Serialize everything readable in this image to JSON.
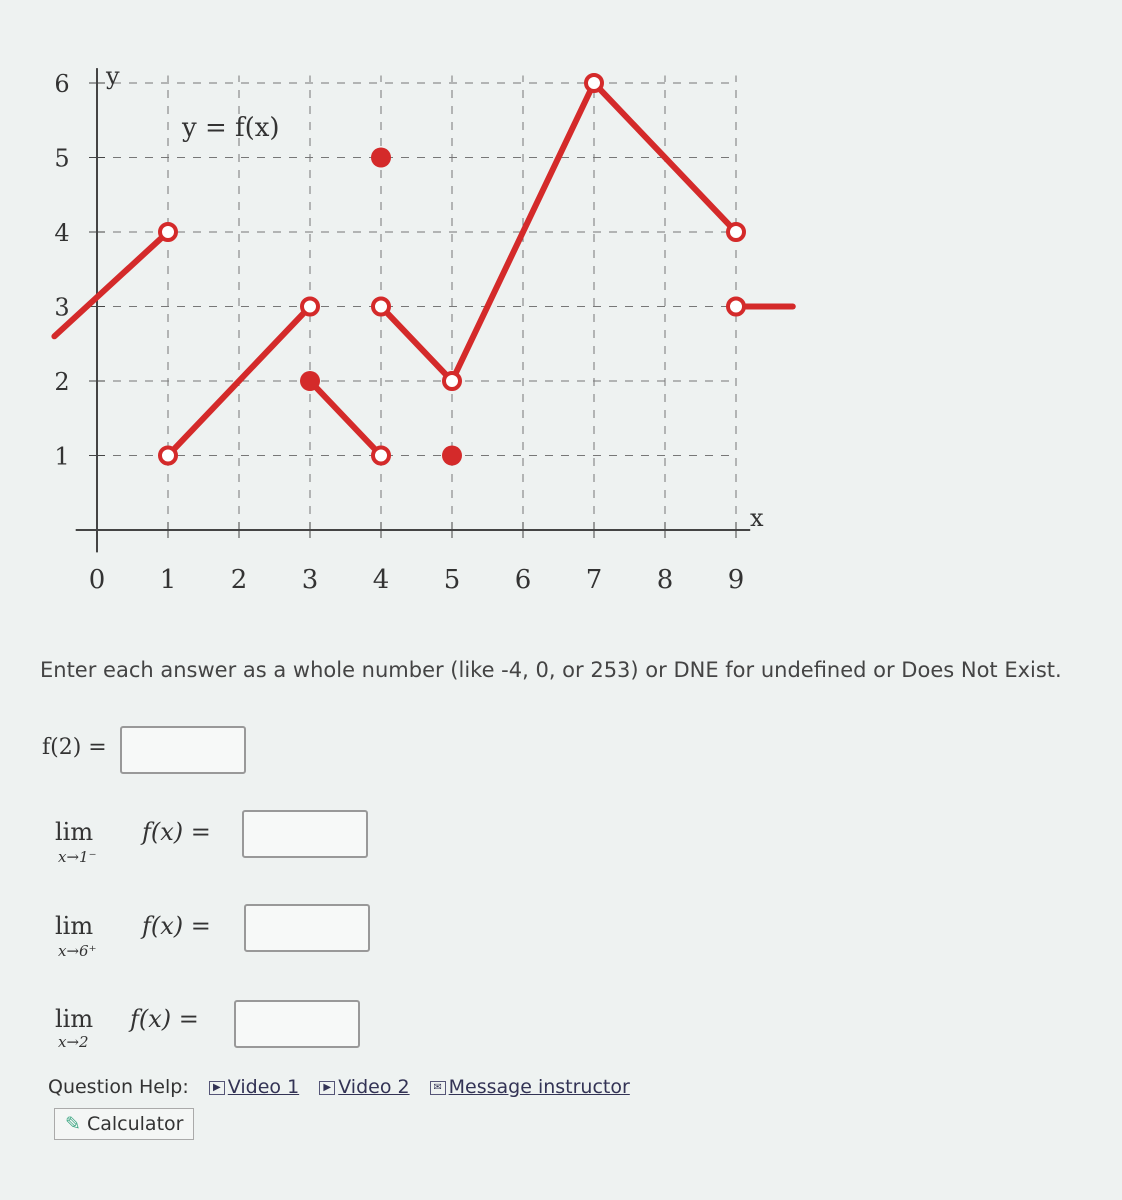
{
  "graph": {
    "title": "y = f(x)",
    "xlabel": "x",
    "ylabel": "y",
    "x_ticks": [
      "0",
      "1",
      "2",
      "3",
      "4",
      "5",
      "6",
      "7",
      "8",
      "9"
    ],
    "y_ticks": [
      "1",
      "2",
      "3",
      "4",
      "5",
      "6"
    ],
    "line_color": "#d42a2a",
    "segments": [
      [
        [
          -0.6,
          2.6
        ],
        [
          1,
          4
        ]
      ],
      [
        [
          1,
          1
        ],
        [
          3,
          3
        ]
      ],
      [
        [
          3,
          2
        ],
        [
          4,
          1
        ]
      ],
      [
        [
          4,
          3
        ],
        [
          5,
          2
        ]
      ],
      [
        [
          5,
          2
        ],
        [
          7,
          6
        ]
      ],
      [
        [
          7,
          6
        ],
        [
          9,
          4
        ]
      ],
      [
        [
          9,
          3
        ],
        [
          9.8,
          3
        ]
      ]
    ],
    "open_points": [
      [
        1,
        4
      ],
      [
        1,
        1
      ],
      [
        3,
        3
      ],
      [
        4,
        1
      ],
      [
        4,
        3
      ],
      [
        5,
        2
      ],
      [
        7,
        6
      ],
      [
        9,
        4
      ],
      [
        9,
        3
      ]
    ],
    "closed_points": [
      [
        3,
        2
      ],
      [
        4,
        5
      ],
      [
        5,
        1
      ]
    ]
  },
  "instructions": "Enter each answer as a whole number (like -4, 0, or 253) or DNE for undefined or Does Not Exist.",
  "questions": [
    {
      "label": "f(2) =",
      "value": ""
    },
    {
      "lim": "lim",
      "sub": "x→1⁻",
      "expr": "f(x) =",
      "value": ""
    },
    {
      "lim": "lim",
      "sub": "x→6⁺",
      "expr": "f(x) =",
      "value": ""
    },
    {
      "lim": "lim",
      "sub": "x→2",
      "expr": "f(x) =",
      "value": ""
    }
  ],
  "help": {
    "label": "Question Help:",
    "video1": "Video 1",
    "video2": "Video 2",
    "message": "Message instructor",
    "calculator": "Calculator"
  }
}
